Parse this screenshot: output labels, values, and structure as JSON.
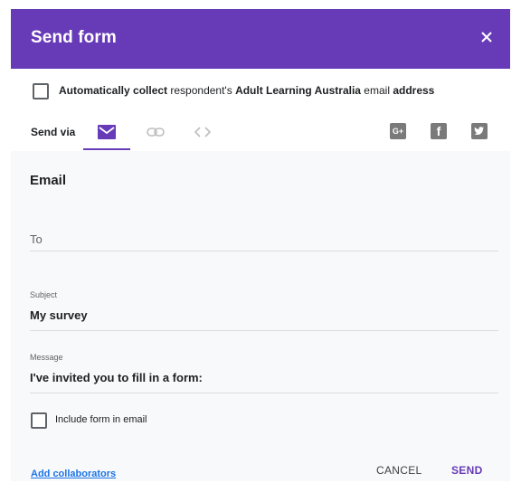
{
  "header": {
    "title": "Send form",
    "close_icon": "close-icon",
    "background": "#673ab7"
  },
  "collect": {
    "prefix": "Automatically collect",
    "middle": " respondent's ",
    "org": "Adult Learning Australia",
    "suffix_plain": " email ",
    "suffix_bold": "address",
    "checked": false
  },
  "send_via": {
    "label": "Send via",
    "tabs": [
      {
        "name": "email",
        "icon": "mail-icon",
        "active": true
      },
      {
        "name": "link",
        "icon": "link-icon",
        "active": false
      },
      {
        "name": "embed",
        "icon": "embed-code-icon",
        "active": false
      }
    ],
    "social": [
      {
        "name": "google-plus",
        "icon": "google-plus-icon",
        "glyph": "G+"
      },
      {
        "name": "facebook",
        "icon": "facebook-icon",
        "glyph": "f"
      },
      {
        "name": "twitter",
        "icon": "twitter-icon",
        "glyph": "t"
      }
    ]
  },
  "email": {
    "section_title": "Email",
    "to_placeholder": "To",
    "subject_label": "Subject",
    "subject_value": "My survey",
    "message_label": "Message",
    "message_value": "I've invited you to fill in a form:",
    "include_label": "Include form in email",
    "include_checked": false
  },
  "footer": {
    "add_collaborators": "Add collaborators",
    "cancel_label": "CANCEL",
    "send_label": "SEND"
  },
  "colors": {
    "accent": "#673ab7",
    "link": "#1a73e8"
  }
}
